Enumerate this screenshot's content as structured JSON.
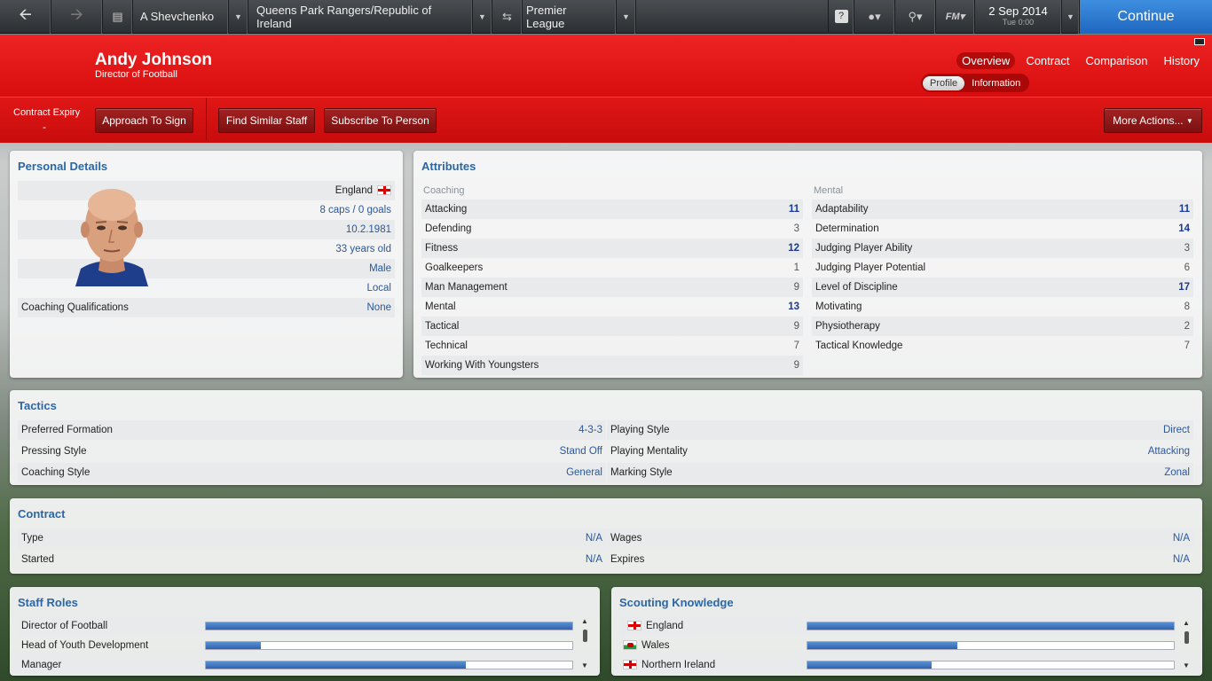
{
  "topbar": {
    "manager": "A Shevchenko",
    "club": "Queens Park Rangers/Republic of Ireland",
    "competition": "Premier League",
    "help": "?",
    "fm_label": "FM",
    "date": "2 Sep 2014",
    "time": "Tue 0:00",
    "continue_label": "Continue"
  },
  "header": {
    "name": "Andy Johnson",
    "role": "Director of Football",
    "tabs": [
      "Overview",
      "Contract",
      "Comparison",
      "History"
    ],
    "subtabs": [
      "Profile",
      "Information"
    ]
  },
  "actions": {
    "contract_expiry_label": "Contract Expiry",
    "contract_expiry_value": "-",
    "approach": "Approach To Sign",
    "find_similar": "Find Similar Staff",
    "subscribe": "Subscribe To Person",
    "more": "More Actions..."
  },
  "personal": {
    "title": "Personal Details",
    "nationality": "England",
    "caps": "8 caps / 0 goals",
    "dob": "10.2.1981",
    "age": "33 years old",
    "gender": "Male",
    "local": "Local",
    "qual_label": "Coaching Qualifications",
    "qual_value": "None"
  },
  "attributes": {
    "title": "Attributes",
    "coaching_head": "Coaching",
    "mental_head": "Mental",
    "coaching": [
      {
        "name": "Attacking",
        "value": "11"
      },
      {
        "name": "Defending",
        "value": "3"
      },
      {
        "name": "Fitness",
        "value": "12"
      },
      {
        "name": "Goalkeepers",
        "value": "1"
      },
      {
        "name": "Man Management",
        "value": "9"
      },
      {
        "name": "Mental",
        "value": "13"
      },
      {
        "name": "Tactical",
        "value": "9"
      },
      {
        "name": "Technical",
        "value": "7"
      },
      {
        "name": "Working With Youngsters",
        "value": "9"
      }
    ],
    "mental": [
      {
        "name": "Adaptability",
        "value": "11"
      },
      {
        "name": "Determination",
        "value": "14"
      },
      {
        "name": "Judging Player Ability",
        "value": "3"
      },
      {
        "name": "Judging Player Potential",
        "value": "6"
      },
      {
        "name": "Level of Discipline",
        "value": "17"
      },
      {
        "name": "Motivating",
        "value": "8"
      },
      {
        "name": "Physiotherapy",
        "value": "2"
      },
      {
        "name": "Tactical Knowledge",
        "value": "7"
      }
    ]
  },
  "tactics": {
    "title": "Tactics",
    "left": [
      {
        "label": "Preferred Formation",
        "value": "4-3-3"
      },
      {
        "label": "Pressing Style",
        "value": "Stand Off"
      },
      {
        "label": "Coaching Style",
        "value": "General"
      }
    ],
    "right": [
      {
        "label": "Playing Style",
        "value": "Direct"
      },
      {
        "label": "Playing Mentality",
        "value": "Attacking"
      },
      {
        "label": "Marking Style",
        "value": "Zonal"
      }
    ]
  },
  "contract": {
    "title": "Contract",
    "left": [
      {
        "label": "Type",
        "value": "N/A"
      },
      {
        "label": "Started",
        "value": "N/A"
      }
    ],
    "right": [
      {
        "label": "Wages",
        "value": "N/A"
      },
      {
        "label": "Expires",
        "value": "N/A"
      }
    ]
  },
  "staff_roles": {
    "title": "Staff Roles",
    "items": [
      {
        "label": "Director of Football",
        "level": 1.0
      },
      {
        "label": "Head of Youth Development",
        "level": 0.15
      },
      {
        "label": "Manager",
        "level": 0.71
      }
    ]
  },
  "scouting": {
    "title": "Scouting Knowledge",
    "items": [
      {
        "label": "England",
        "flag": "eng",
        "level": 1.0
      },
      {
        "label": "Wales",
        "flag": "wal",
        "level": 0.41
      },
      {
        "label": "Northern Ireland",
        "flag": "nir",
        "level": 0.34
      }
    ]
  },
  "colors": {
    "header_red": "#e01616",
    "accent_blue": "#2a66a8",
    "continue_blue": "#2a78d4"
  }
}
